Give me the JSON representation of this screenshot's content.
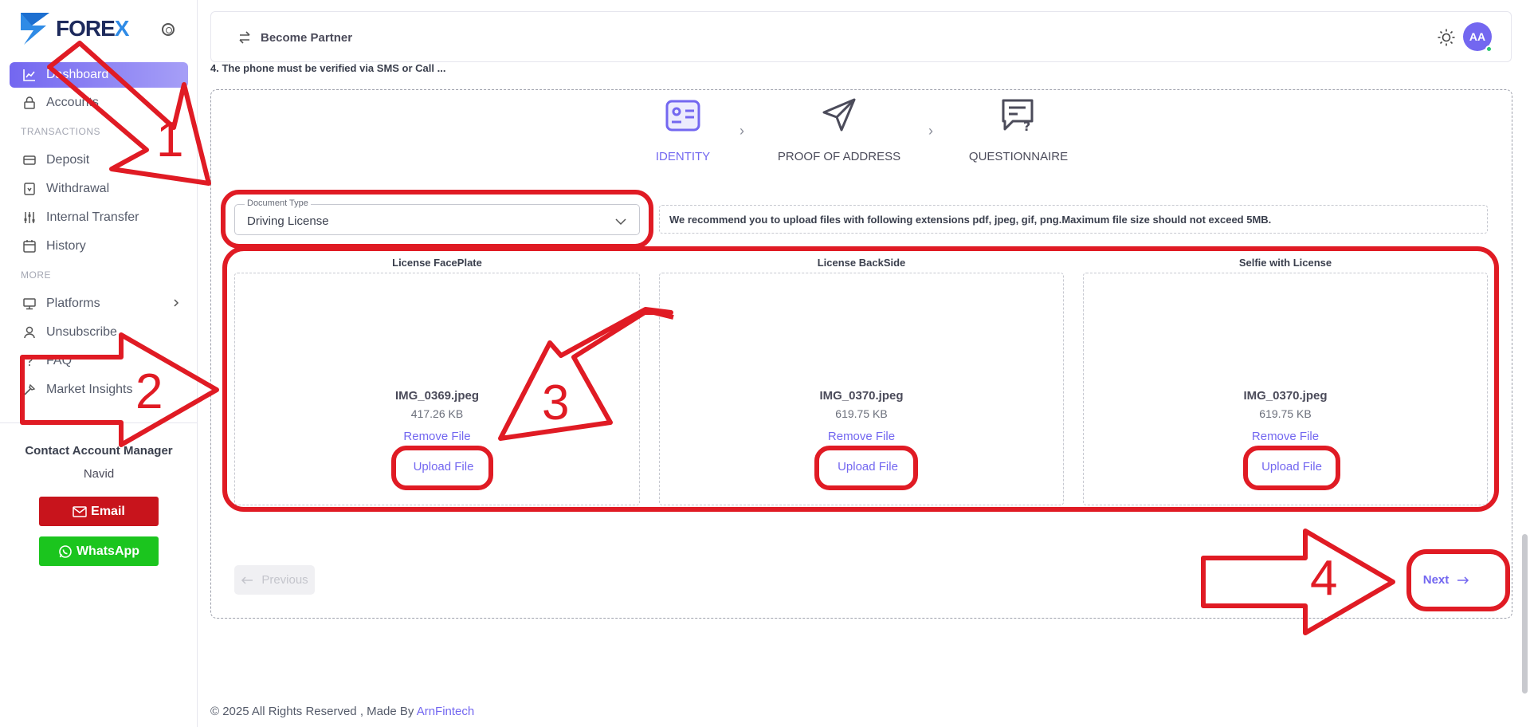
{
  "brand": {
    "logo_text_main": "FORE",
    "logo_text_x": "X"
  },
  "sidebar": {
    "items": [
      {
        "label": "Dashboard",
        "icon": "chart-icon",
        "active": true
      },
      {
        "label": "Accounts",
        "icon": "lock-icon"
      },
      {
        "label": "Deposit",
        "icon": "card-icon"
      },
      {
        "label": "Withdrawal",
        "icon": "withdraw-icon"
      },
      {
        "label": "Internal Transfer",
        "icon": "sliders-icon"
      },
      {
        "label": "History",
        "icon": "calendar-icon"
      },
      {
        "label": "Platforms",
        "icon": "monitor-icon"
      },
      {
        "label": "Unsubscribe",
        "icon": "user-icon"
      },
      {
        "label": "FAQ",
        "icon": "question-icon"
      },
      {
        "label": "Market Insights",
        "icon": "tool-icon"
      }
    ],
    "sections": {
      "transactions": "TRANSACTIONS",
      "more": "MORE"
    },
    "contact": {
      "title": "Contact Account Manager",
      "name": "Navid",
      "email_label": "Email",
      "whatsapp_label": "WhatsApp"
    }
  },
  "topbar": {
    "become_partner": "Become Partner",
    "avatar_initials": "AA"
  },
  "notice": "4. The phone must be verified via SMS or Call ...",
  "steps": [
    {
      "label": "IDENTITY",
      "icon": "id-card-icon",
      "active": true
    },
    {
      "label": "PROOF OF ADDRESS",
      "icon": "send-icon",
      "active": false
    },
    {
      "label": "QUESTIONNAIRE",
      "icon": "chat-question-icon",
      "active": false
    }
  ],
  "document_type": {
    "label": "Document Type",
    "value": "Driving License"
  },
  "recommendation": "We recommend you to upload files with following extensions pdf, jpeg, gif, png.Maximum file size should not exceed 5MB.",
  "uploads": [
    {
      "title": "License FacePlate",
      "file_name": "IMG_0369.jpeg",
      "file_size": "417.26 KB",
      "remove": "Remove File",
      "upload": "Upload File"
    },
    {
      "title": "License BackSide",
      "file_name": "IMG_0370.jpeg",
      "file_size": "619.75 KB",
      "remove": "Remove File",
      "upload": "Upload File"
    },
    {
      "title": "Selfie with License",
      "file_name": "IMG_0370.jpeg",
      "file_size": "619.75 KB",
      "remove": "Remove File",
      "upload": "Upload File"
    }
  ],
  "nav_buttons": {
    "previous": "Previous",
    "next": "Next"
  },
  "footer": {
    "text": "© 2025 All Rights Reserved , Made By ",
    "link": "ArnFintech"
  },
  "annotations": [
    "1",
    "2",
    "3",
    "4"
  ],
  "colors": {
    "accent": "#7367f0",
    "annotation": "#e01b24",
    "email": "#c8141c",
    "whatsapp": "#1bc51e"
  }
}
